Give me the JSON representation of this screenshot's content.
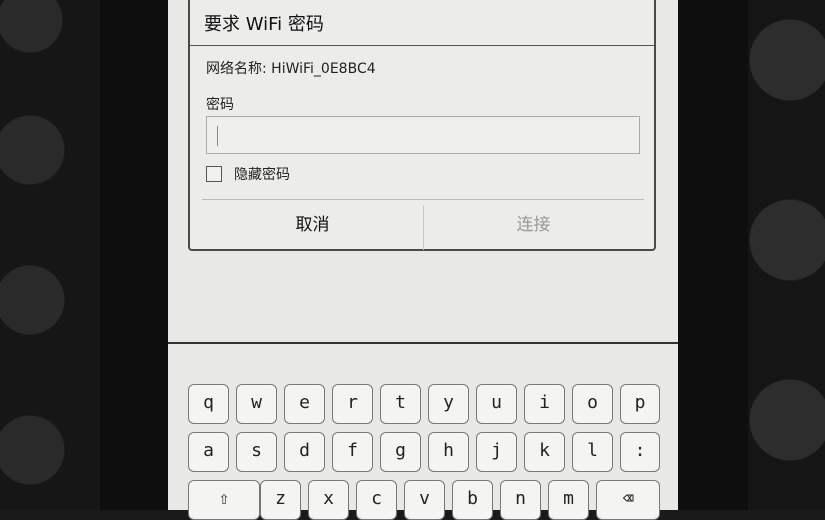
{
  "dialog": {
    "title": "要求 WiFi 密码",
    "network_label": "网络名称: HiWiFi_0E8BC4",
    "password_label": "密码",
    "password_value": "",
    "hide_password_label": "隐藏密码",
    "cancel_label": "取消",
    "connect_label": "连接"
  },
  "keyboard": {
    "row1": [
      "q",
      "w",
      "e",
      "r",
      "t",
      "y",
      "u",
      "i",
      "o",
      "p"
    ],
    "row2": [
      "a",
      "s",
      "d",
      "f",
      "g",
      "h",
      "j",
      "k",
      "l",
      ":"
    ],
    "row3": [
      "⇧",
      "z",
      "x",
      "c",
      "v",
      "b",
      "n",
      "m",
      "⌫"
    ]
  }
}
